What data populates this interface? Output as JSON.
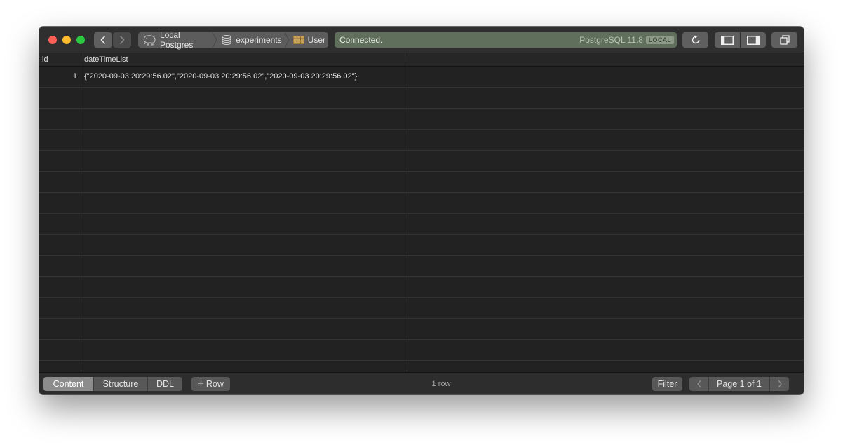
{
  "toolbar": {
    "breadcrumbs": [
      {
        "label": "Local Postgres",
        "icon": "elephant-icon"
      },
      {
        "label": "experiments",
        "icon": "database-icon"
      },
      {
        "label": "User",
        "icon": "table-icon"
      }
    ],
    "status": {
      "message": "Connected.",
      "server": "PostgreSQL 11.8",
      "badge": "LOCAL",
      "color": "#5f6f5b"
    }
  },
  "table": {
    "columns": [
      "id",
      "dateTimeList"
    ],
    "rows": [
      {
        "id": "1",
        "dateTimeList": "{\"2020-09-03 20:29:56.02\",\"2020-09-03 20:29:56.02\",\"2020-09-03 20:29:56.02\"}"
      }
    ]
  },
  "footer": {
    "tabs": [
      "Content",
      "Structure",
      "DDL"
    ],
    "active_tab": "Content",
    "add_row_label": "Row",
    "row_count": "1 row",
    "filter_label": "Filter",
    "page_label": "Page 1 of 1"
  }
}
